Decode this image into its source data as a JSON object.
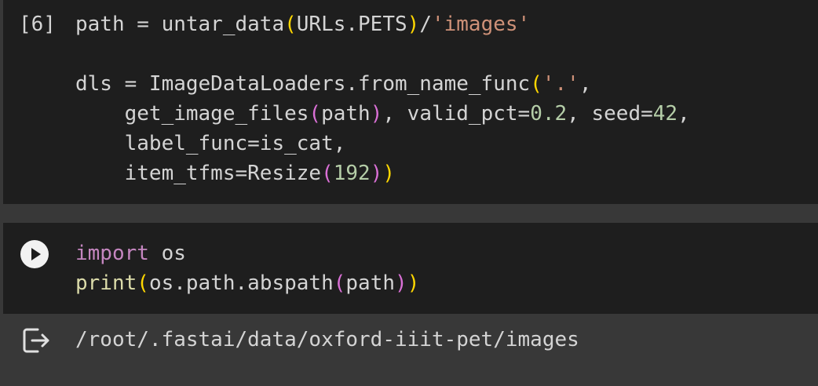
{
  "cells": [
    {
      "execution_count": "[6]",
      "lines": [
        [
          {
            "t": "path = untar_data",
            "c": "plain"
          },
          {
            "t": "(",
            "c": "br1"
          },
          {
            "t": "URLs.PETS",
            "c": "plain"
          },
          {
            "t": ")",
            "c": "br1"
          },
          {
            "t": "/",
            "c": "plain"
          },
          {
            "t": "'images'",
            "c": "str"
          }
        ],
        [],
        [
          {
            "t": "dls = ImageDataLoaders.from_name_func",
            "c": "plain"
          },
          {
            "t": "(",
            "c": "br1"
          },
          {
            "t": "'.'",
            "c": "str"
          },
          {
            "t": ",",
            "c": "plain"
          }
        ],
        [
          {
            "t": "    get_image_files",
            "c": "plain"
          },
          {
            "t": "(",
            "c": "br2"
          },
          {
            "t": "path",
            "c": "plain"
          },
          {
            "t": ")",
            "c": "br2"
          },
          {
            "t": ", valid_pct=",
            "c": "plain"
          },
          {
            "t": "0.2",
            "c": "num"
          },
          {
            "t": ", seed=",
            "c": "plain"
          },
          {
            "t": "42",
            "c": "num"
          },
          {
            "t": ",",
            "c": "plain"
          }
        ],
        [
          {
            "t": "    label_func=is_cat,",
            "c": "plain"
          }
        ],
        [
          {
            "t": "    item_tfms=Resize",
            "c": "plain"
          },
          {
            "t": "(",
            "c": "br2"
          },
          {
            "t": "192",
            "c": "num"
          },
          {
            "t": ")",
            "c": "br2"
          },
          {
            "t": ")",
            "c": "br1"
          }
        ]
      ]
    },
    {
      "run_button_icon": "play-icon",
      "lines": [
        [
          {
            "t": "import",
            "c": "kw"
          },
          {
            "t": " os",
            "c": "plain"
          }
        ],
        [
          {
            "t": "print",
            "c": "fn"
          },
          {
            "t": "(",
            "c": "br1"
          },
          {
            "t": "os.path.abspath",
            "c": "plain"
          },
          {
            "t": "(",
            "c": "br2"
          },
          {
            "t": "path",
            "c": "plain"
          },
          {
            "t": ")",
            "c": "br2"
          },
          {
            "t": ")",
            "c": "br1"
          }
        ]
      ]
    }
  ],
  "output": {
    "icon": "output-redirect-icon",
    "text": "/root/.fastai/data/oxford-iiit-pet/images"
  },
  "colors": {
    "cell_background": "#1e1e1e",
    "page_background": "#383838",
    "string": "#ce9178",
    "number": "#b5cea8",
    "keyword": "#c586c0",
    "function": "#dcdcaa",
    "bracket_level1": "#ffd700",
    "bracket_level2": "#da70d6"
  }
}
